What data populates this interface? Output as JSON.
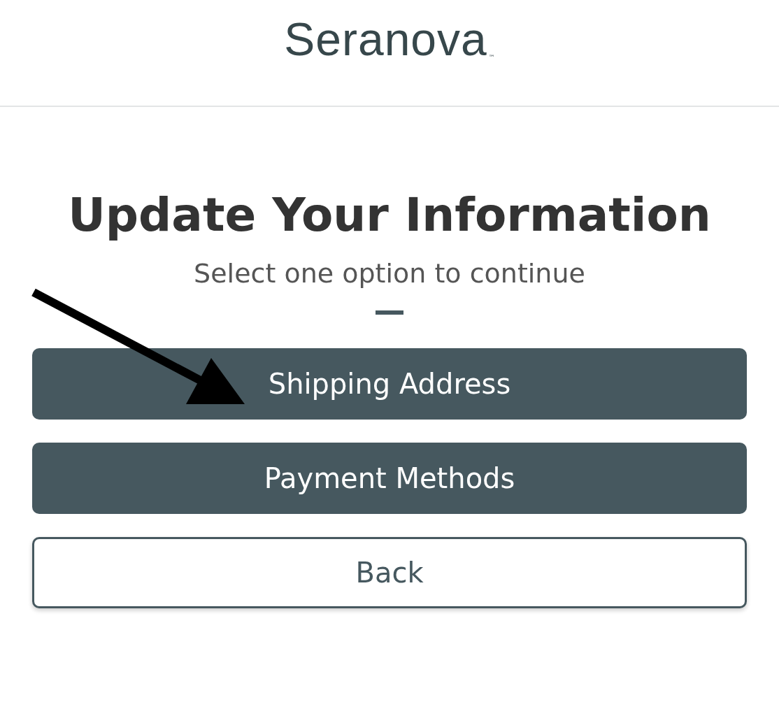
{
  "header": {
    "logo": "Seranova",
    "trademark": "™"
  },
  "title": "Update Your Information",
  "subtitle": "Select one option to continue",
  "buttons": [
    {
      "label": "Shipping Address",
      "kind": "primary"
    },
    {
      "label": "Payment Methods",
      "kind": "primary"
    },
    {
      "label": "Back",
      "kind": "outline"
    }
  ]
}
